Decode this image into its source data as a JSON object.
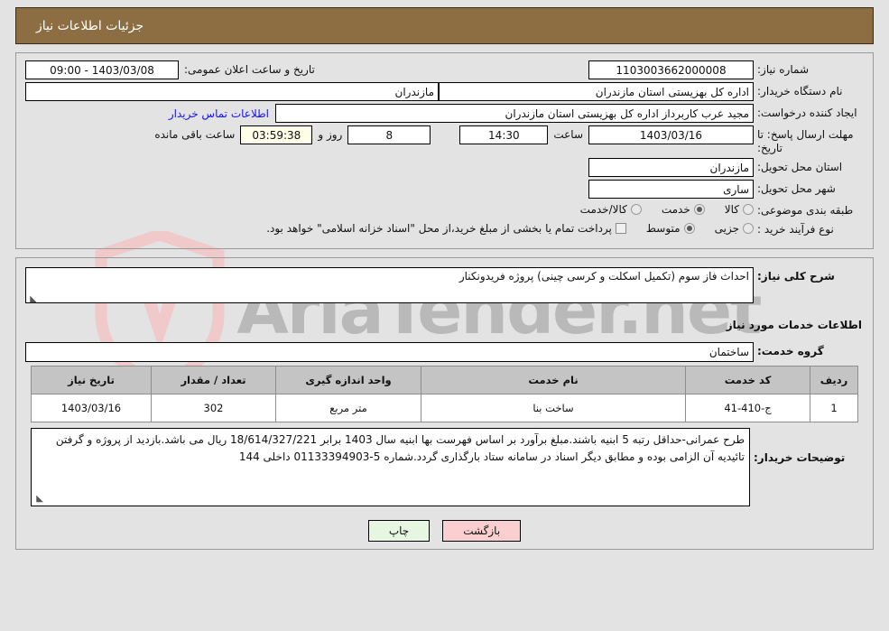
{
  "header": {
    "title": "جزئیات اطلاعات نیاز"
  },
  "colors": {
    "header_bar": "#8d6e42",
    "page_background": "#e3e3e3",
    "table_header": "#c4c4c4",
    "link": "#1414ff",
    "countdown_field": "#fdfde8",
    "back_button": "#fbcfcf",
    "print_button": "#e6f6e1"
  },
  "form": {
    "need_number_label": "شماره نیاز:",
    "need_number_value": "1103003662000008",
    "public_announce_label": "تاریخ و ساعت اعلان عمومی:",
    "public_announce_value": "1403/03/08 - 09:00",
    "buyer_org_label": "نام دستگاه خریدار:",
    "buyer_org_value": "اداره کل بهزیستی استان مازندران",
    "buyer_org_province_value": "مازندران",
    "requester_label": "ایجاد کننده درخواست:",
    "requester_value": "مجید عرب کاربرداز اداره کل بهزیستی استان مازندران",
    "contact_link": "اطلاعات تماس خریدار",
    "deadline_label": "مهلت ارسال پاسخ: تا تاریخ:",
    "deadline_date": "1403/03/16",
    "deadline_time_label": "ساعت",
    "deadline_time": "14:30",
    "remaining_days": "8",
    "remaining_days_label": "روز و",
    "remaining_clock": "03:59:38",
    "remaining_suffix": "ساعت باقی مانده",
    "delivery_province_label": "استان محل تحویل:",
    "delivery_province_value": "مازندران",
    "delivery_city_label": "شهر محل تحویل:",
    "delivery_city_value": "ساری",
    "category_label": "طبقه بندی موضوعی:",
    "category_options": [
      {
        "label": "کالا",
        "selected": false
      },
      {
        "label": "خدمت",
        "selected": true
      },
      {
        "label": "کالا/خدمت",
        "selected": false
      }
    ],
    "process_label": "نوع فرآیند خرید :",
    "process_options": [
      {
        "label": "جزیی",
        "selected": false
      },
      {
        "label": "متوسط",
        "selected": true
      }
    ],
    "treasury_checkbox_label": "پرداخت تمام یا بخشی از مبلغ خرید،از محل \"اسناد خزانه اسلامی\" خواهد بود.",
    "treasury_checked": false
  },
  "need_summary": {
    "label": "شرح کلی نیاز:",
    "value": "احداث فاز سوم (تکمیل اسکلت و کرسی چینی) پروژه فریدونکنار"
  },
  "services_section": {
    "title": "اطلاعات خدمات مورد نیاز",
    "group_label": "گروه خدمت:",
    "group_value": "ساختمان"
  },
  "table": {
    "columns": [
      "ردیف",
      "کد خدمت",
      "نام خدمت",
      "واحد اندازه گیری",
      "تعداد / مقدار",
      "تاریخ نیاز"
    ],
    "rows": [
      {
        "row": "1",
        "code": "ج-410-41",
        "name": "ساخت بنا",
        "unit": "متر مربع",
        "qty": "302",
        "date": "1403/03/16"
      }
    ]
  },
  "buyer_notes": {
    "label": "توضیحات خریدار:",
    "value": "طرح عمرانی-حداقل رتبه 5 ابنیه باشند.مبلغ برآورد بر اساس فهرست بها ابنیه سال 1403 برابر 18/614/327/221 ریال می باشد.بازدید از پروژه و گرفتن تائیدیه آن الزامی بوده و مطابق دیگر اسناد در سامانه ستاد بارگذاری گردد.شماره 5-01133394903 داخلی 144"
  },
  "buttons": {
    "back": "بازگشت",
    "print": "چاپ"
  },
  "watermark": {
    "text": "AriaTender.net"
  }
}
